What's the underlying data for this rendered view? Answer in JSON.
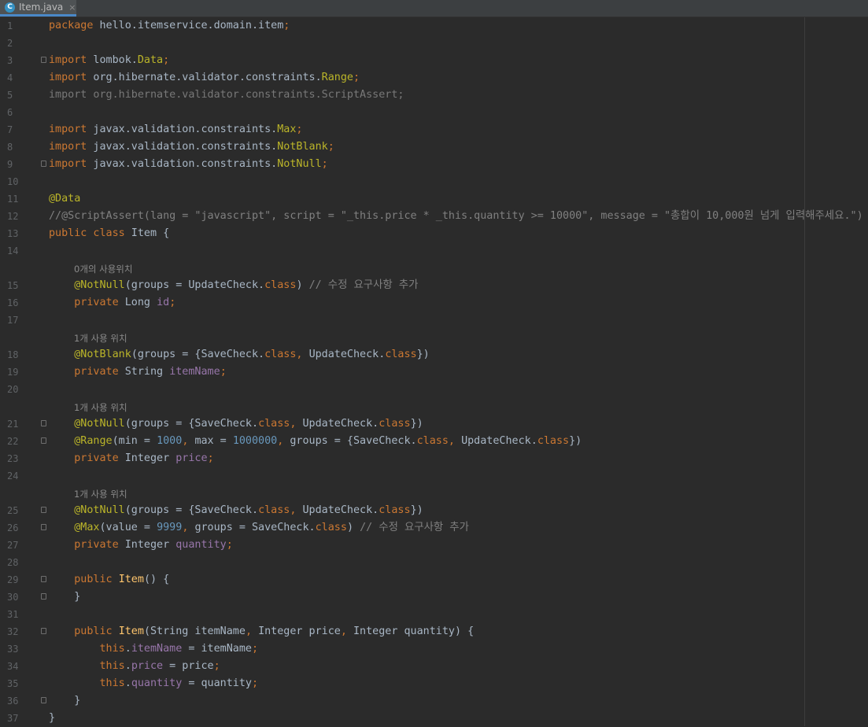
{
  "tab": {
    "filename": "Item.java",
    "icon": "C",
    "close": "×"
  },
  "lines": {
    "l1": {
      "n": "1",
      "t": [
        {
          "c": "kw",
          "v": "package"
        },
        {
          "v": " hello.itemservice.domain.item"
        },
        {
          "c": "kw",
          "v": ";"
        }
      ]
    },
    "l2": {
      "n": "2",
      "t": []
    },
    "l3": {
      "n": "3",
      "t": [
        {
          "c": "kw",
          "v": "import"
        },
        {
          "v": " lombok."
        },
        {
          "c": "an",
          "v": "Data"
        },
        {
          "c": "kw",
          "v": ";"
        }
      ]
    },
    "l4": {
      "n": "4",
      "t": [
        {
          "c": "kw",
          "v": "import"
        },
        {
          "v": " org.hibernate.validator.constraints."
        },
        {
          "c": "an",
          "v": "Range"
        },
        {
          "c": "kw",
          "v": ";"
        }
      ]
    },
    "l5": {
      "n": "5",
      "t": [
        {
          "c": "gr",
          "v": "import org.hibernate.validator.constraints.ScriptAssert;"
        }
      ]
    },
    "l6": {
      "n": "6",
      "t": []
    },
    "l7": {
      "n": "7",
      "t": [
        {
          "c": "kw",
          "v": "import"
        },
        {
          "v": " javax.validation.constraints."
        },
        {
          "c": "an",
          "v": "Max"
        },
        {
          "c": "kw",
          "v": ";"
        }
      ]
    },
    "l8": {
      "n": "8",
      "t": [
        {
          "c": "kw",
          "v": "import"
        },
        {
          "v": " javax.validation.constraints."
        },
        {
          "c": "an",
          "v": "NotBlank"
        },
        {
          "c": "kw",
          "v": ";"
        }
      ]
    },
    "l9": {
      "n": "9",
      "t": [
        {
          "c": "kw",
          "v": "import"
        },
        {
          "v": " javax.validation.constraints."
        },
        {
          "c": "an",
          "v": "NotNull"
        },
        {
          "c": "kw",
          "v": ";"
        }
      ]
    },
    "l10": {
      "n": "10",
      "t": []
    },
    "l11": {
      "n": "11",
      "t": [
        {
          "c": "an",
          "v": "@Data"
        }
      ]
    },
    "l12": {
      "n": "12",
      "t": [
        {
          "c": "cm",
          "v": "//@ScriptAssert(lang = \"javascript\", script = \"_this.price * _this.quantity >= 10000\", message = \"총합이 10,000원 넘게 입력해주세요.\")"
        }
      ]
    },
    "l13": {
      "n": "13",
      "t": [
        {
          "c": "kw",
          "v": "public class"
        },
        {
          "v": " Item {"
        }
      ]
    },
    "l14": {
      "n": "14",
      "t": []
    },
    "l15": {
      "n": "15",
      "t": [
        {
          "v": "    "
        },
        {
          "c": "an",
          "v": "@NotNull"
        },
        {
          "v": "(groups = UpdateCheck."
        },
        {
          "c": "kw",
          "v": "class"
        },
        {
          "v": ") "
        },
        {
          "c": "cm",
          "v": "// 수정 요구사항 추가"
        }
      ]
    },
    "l16": {
      "n": "16",
      "t": [
        {
          "v": "    "
        },
        {
          "c": "kw",
          "v": "private"
        },
        {
          "v": " Long "
        },
        {
          "c": "fd",
          "v": "id"
        },
        {
          "c": "kw",
          "v": ";"
        }
      ]
    },
    "l17": {
      "n": "17",
      "t": []
    },
    "l18": {
      "n": "18",
      "t": [
        {
          "v": "    "
        },
        {
          "c": "an",
          "v": "@NotBlank"
        },
        {
          "v": "(groups = {SaveCheck."
        },
        {
          "c": "kw",
          "v": "class, "
        },
        {
          "v": "UpdateCheck."
        },
        {
          "c": "kw",
          "v": "class"
        },
        {
          "v": "})"
        }
      ]
    },
    "l19": {
      "n": "19",
      "t": [
        {
          "v": "    "
        },
        {
          "c": "kw",
          "v": "private"
        },
        {
          "v": " String "
        },
        {
          "c": "fd",
          "v": "itemName"
        },
        {
          "c": "kw",
          "v": ";"
        }
      ]
    },
    "l20": {
      "n": "20",
      "t": []
    },
    "l21": {
      "n": "21",
      "t": [
        {
          "v": "    "
        },
        {
          "c": "an",
          "v": "@NotNull"
        },
        {
          "v": "(groups = {SaveCheck."
        },
        {
          "c": "kw",
          "v": "class, "
        },
        {
          "v": "UpdateCheck."
        },
        {
          "c": "kw",
          "v": "class"
        },
        {
          "v": "})"
        }
      ]
    },
    "l22": {
      "n": "22",
      "t": [
        {
          "v": "    "
        },
        {
          "c": "an",
          "v": "@Range"
        },
        {
          "v": "(min = "
        },
        {
          "c": "nu",
          "v": "1000"
        },
        {
          "c": "kw",
          "v": ", "
        },
        {
          "v": "max = "
        },
        {
          "c": "nu",
          "v": "1000000"
        },
        {
          "c": "kw",
          "v": ", "
        },
        {
          "v": "groups = {SaveCheck."
        },
        {
          "c": "kw",
          "v": "class, "
        },
        {
          "v": "UpdateCheck."
        },
        {
          "c": "kw",
          "v": "class"
        },
        {
          "v": "})"
        }
      ]
    },
    "l23": {
      "n": "23",
      "t": [
        {
          "v": "    "
        },
        {
          "c": "kw",
          "v": "private"
        },
        {
          "v": " Integer "
        },
        {
          "c": "fd",
          "v": "price"
        },
        {
          "c": "kw",
          "v": ";"
        }
      ]
    },
    "l24": {
      "n": "24",
      "t": []
    },
    "l25": {
      "n": "25",
      "t": [
        {
          "v": "    "
        },
        {
          "c": "an",
          "v": "@NotNull"
        },
        {
          "v": "(groups = {SaveCheck."
        },
        {
          "c": "kw",
          "v": "class, "
        },
        {
          "v": "UpdateCheck."
        },
        {
          "c": "kw",
          "v": "class"
        },
        {
          "v": "})"
        }
      ]
    },
    "l26": {
      "n": "26",
      "t": [
        {
          "v": "    "
        },
        {
          "c": "an",
          "v": "@Max"
        },
        {
          "v": "(value = "
        },
        {
          "c": "nu",
          "v": "9999"
        },
        {
          "c": "kw",
          "v": ", "
        },
        {
          "v": "groups = SaveCheck."
        },
        {
          "c": "kw",
          "v": "class"
        },
        {
          "v": ") "
        },
        {
          "c": "cm",
          "v": "// 수정 요구사항 추가"
        }
      ]
    },
    "l27": {
      "n": "27",
      "t": [
        {
          "v": "    "
        },
        {
          "c": "kw",
          "v": "private"
        },
        {
          "v": " Integer "
        },
        {
          "c": "fd",
          "v": "quantity"
        },
        {
          "c": "kw",
          "v": ";"
        }
      ]
    },
    "l28": {
      "n": "28",
      "t": []
    },
    "l29": {
      "n": "29",
      "t": [
        {
          "v": "    "
        },
        {
          "c": "kw",
          "v": "public "
        },
        {
          "c": "fn",
          "v": "Item"
        },
        {
          "v": "() {"
        }
      ]
    },
    "l30": {
      "n": "30",
      "t": [
        {
          "v": "    }"
        }
      ]
    },
    "l31": {
      "n": "31",
      "t": []
    },
    "l32": {
      "n": "32",
      "t": [
        {
          "v": "    "
        },
        {
          "c": "kw",
          "v": "public "
        },
        {
          "c": "fn",
          "v": "Item"
        },
        {
          "v": "(String itemName"
        },
        {
          "c": "kw",
          "v": ", "
        },
        {
          "v": "Integer price"
        },
        {
          "c": "kw",
          "v": ", "
        },
        {
          "v": "Integer quantity) {"
        }
      ]
    },
    "l33": {
      "n": "33",
      "t": [
        {
          "v": "        "
        },
        {
          "c": "kw",
          "v": "this"
        },
        {
          "v": "."
        },
        {
          "c": "fd",
          "v": "itemName"
        },
        {
          "v": " = itemName"
        },
        {
          "c": "kw",
          "v": ";"
        }
      ]
    },
    "l34": {
      "n": "34",
      "t": [
        {
          "v": "        "
        },
        {
          "c": "kw",
          "v": "this"
        },
        {
          "v": "."
        },
        {
          "c": "fd",
          "v": "price"
        },
        {
          "v": " = price"
        },
        {
          "c": "kw",
          "v": ";"
        }
      ]
    },
    "l35": {
      "n": "35",
      "t": [
        {
          "v": "        "
        },
        {
          "c": "kw",
          "v": "this"
        },
        {
          "v": "."
        },
        {
          "c": "fd",
          "v": "quantity"
        },
        {
          "v": " = quantity"
        },
        {
          "c": "kw",
          "v": ";"
        }
      ]
    },
    "l36": {
      "n": "36",
      "t": [
        {
          "v": "    }"
        }
      ]
    },
    "l37": {
      "n": "37",
      "t": [
        {
          "v": "}"
        }
      ]
    }
  },
  "hints": {
    "h1": "0개의 사용위치",
    "h2": "1개 사용 위치",
    "h3": "1개 사용 위치",
    "h4": "1개 사용 위치"
  },
  "colors": {
    "background": "#2b2b2b",
    "keyword": "#cc7832",
    "annotation": "#bbb529",
    "number": "#6897bb",
    "field": "#9876aa",
    "comment": "#808080",
    "method": "#ffc66d",
    "text": "#a9b7c6"
  }
}
